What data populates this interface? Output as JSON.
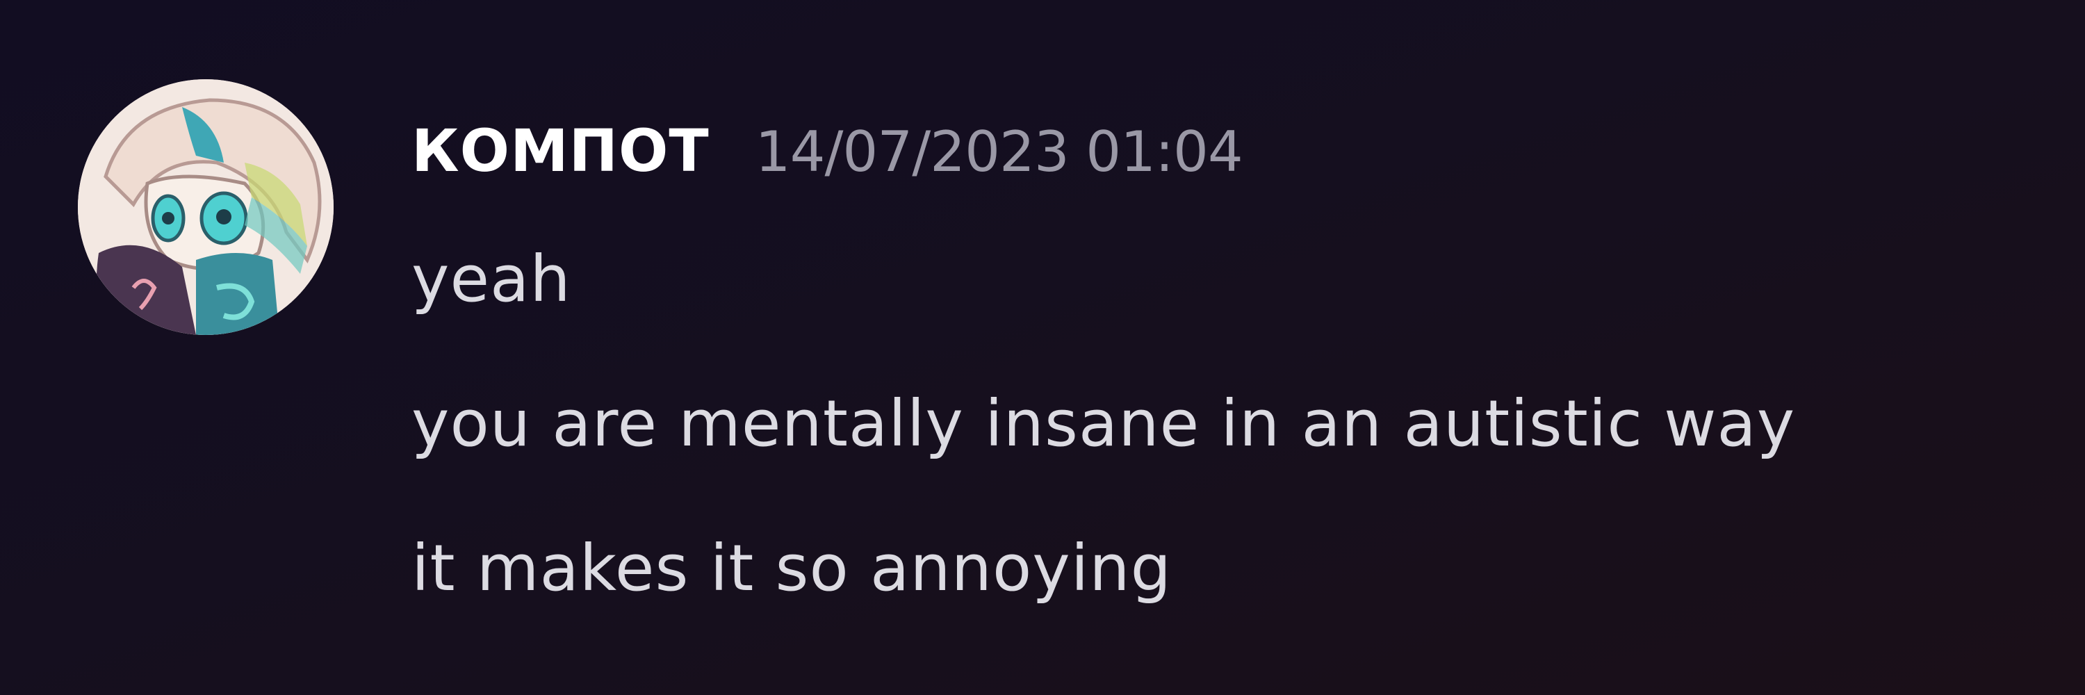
{
  "message": {
    "author": "КОМПОТ",
    "timestamp": "14/07/2023 01:04",
    "avatar_icon": "user-avatar-icon",
    "lines": [
      "yeah",
      "you are mentally insane in an autistic way",
      "it makes it so annoying"
    ]
  },
  "colors": {
    "background": "#140f20",
    "username": "#ffffff",
    "timestamp": "#9a98a6",
    "message_text": "#dcdbe2"
  }
}
